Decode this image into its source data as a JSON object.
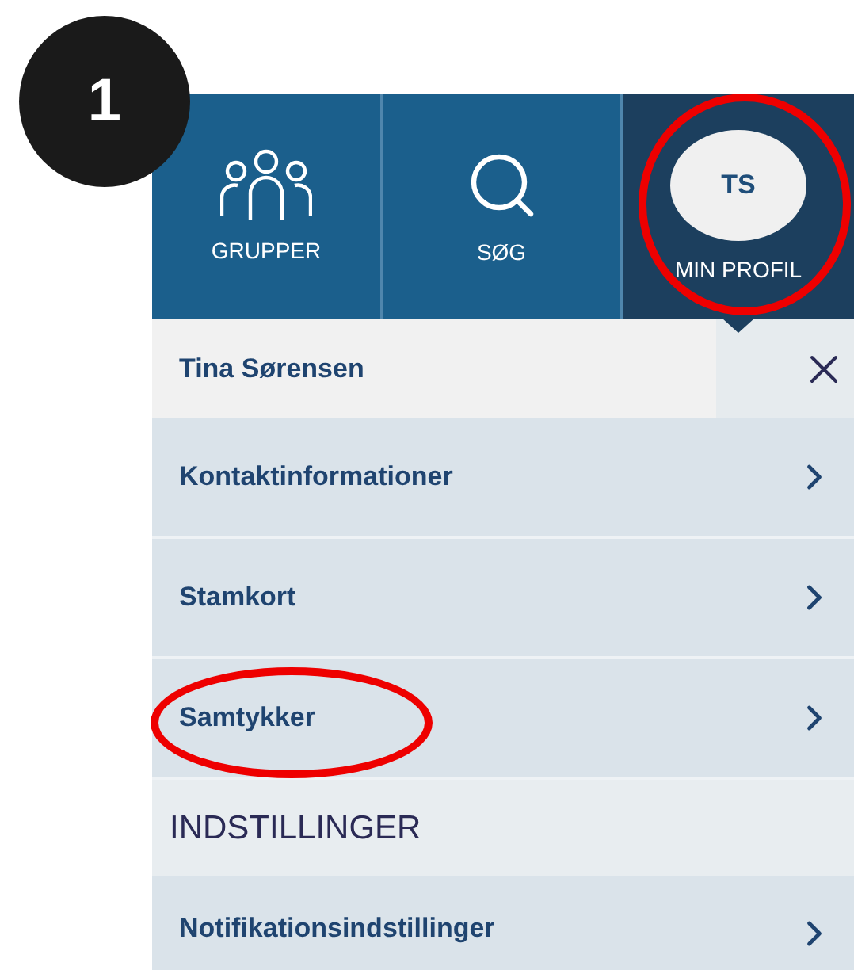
{
  "step_number": "1",
  "tabs": [
    {
      "kind": "groups",
      "label": "GRUPPER",
      "selected": false,
      "annotated": false
    },
    {
      "kind": "search",
      "label": "SØG",
      "selected": false,
      "annotated": false
    },
    {
      "kind": "profile",
      "label": "MIN PROFIL",
      "initials": "TS",
      "selected": true,
      "annotated": true
    }
  ],
  "profile_header": {
    "name": "Tina Sørensen"
  },
  "menu_items": [
    {
      "label": "Kontaktinformationer",
      "annotated": false
    },
    {
      "label": "Stamkort",
      "annotated": false
    },
    {
      "label": "Samtykker",
      "annotated": true
    }
  ],
  "settings_section": {
    "title": "INDSTILLINGER",
    "items": [
      {
        "label": "Notifikationsindstillinger",
        "annotated": false
      }
    ]
  }
}
